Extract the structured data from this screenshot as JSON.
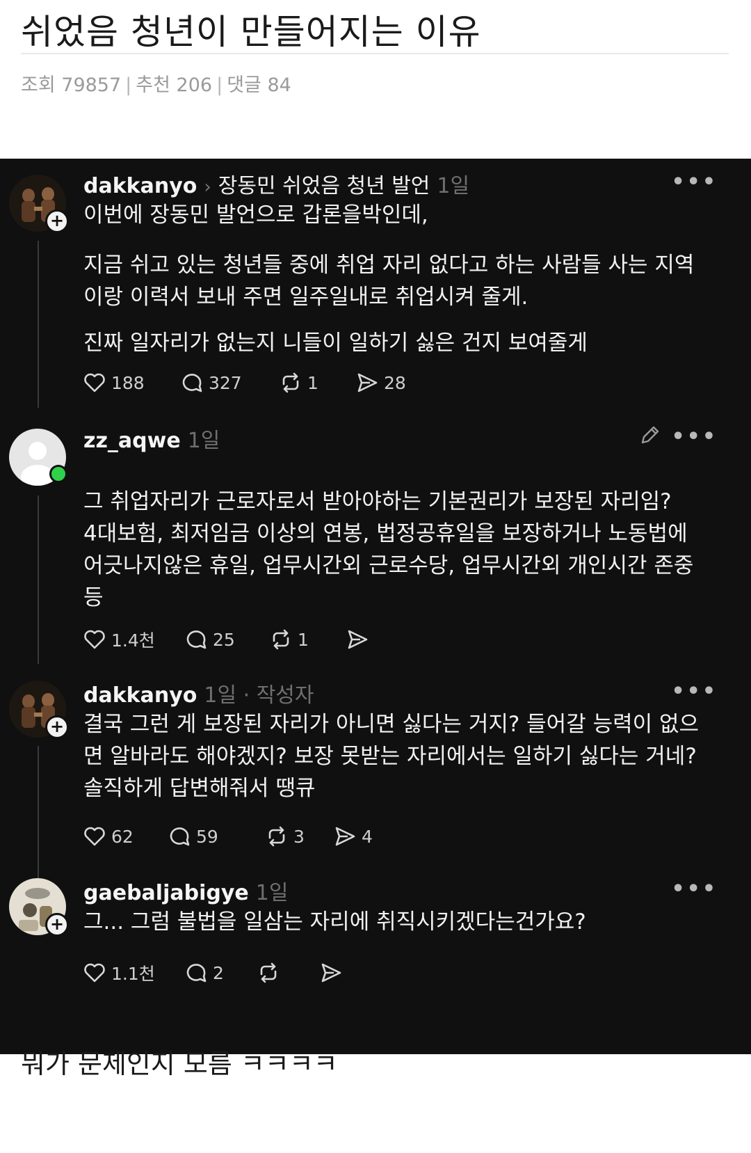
{
  "post": {
    "title": "쉬었음 청년이 만들어지는 이유",
    "views_label": "조회 79857",
    "recommend_label": "추천 206",
    "comments_label": "댓글 84",
    "footer": "뭐가 문제인지 모름 ㅋㅋㅋㅋ"
  },
  "threads": [
    {
      "username": "dakkanyo",
      "reply_target": "장동민 쉬었음 청년 발언",
      "time": "1일",
      "author_tag": "",
      "paragraphs": [
        "이번에 장동민 발언으로 갑론을박인데,",
        "지금 쉬고 있는 청년들 중에 취업 자리 없다고 하는 사람들 사는 지역이랑 이력서 보내 주면 일주일내로 취업시켜 줄게.",
        "진짜 일자리가 없는지 니들이 일하기 싫은 건지 보여줄게"
      ],
      "likes": "188",
      "replies": "327",
      "reposts": "1",
      "shares": "28"
    },
    {
      "username": "zz_aqwe",
      "reply_target": "",
      "time": "1일",
      "author_tag": "",
      "paragraphs": [
        "그 취업자리가 근로자로서 받아야하는 기본권리가 보장된 자리임?\n4대보험, 최저임금 이상의 연봉, 법정공휴일을 보장하거나 노동법에 어긋나지않은 휴일, 업무시간외 근로수당, 업무시간외 개인시간 존중 등"
      ],
      "likes": "1.4천",
      "replies": "25",
      "reposts": "1",
      "shares": ""
    },
    {
      "username": "dakkanyo",
      "reply_target": "",
      "time": "1일",
      "author_tag": "· 작성자",
      "paragraphs": [
        "결국 그런 게 보장된 자리가 아니면 싫다는 거지? 들어갈 능력이 없으면 알바라도 해야겠지? 보장 못받는 자리에서는 일하기 싫다는 거네? 솔직하게 답변해줘서 땡큐"
      ],
      "likes": "62",
      "replies": "59",
      "reposts": "3",
      "shares": "4"
    },
    {
      "username": "gaebaljabigye",
      "reply_target": "",
      "time": "1일",
      "author_tag": "",
      "paragraphs": [
        "그... 그럼 불법을 일삼는 자리에 취직시키겠다는건가요?"
      ],
      "likes": "1.1천",
      "replies": "2",
      "reposts": "",
      "shares": ""
    }
  ],
  "icons": {
    "like": "heart-icon",
    "reply": "comment-bubble-icon",
    "repost": "repost-icon",
    "share": "send-icon",
    "more": "more-horizontal-icon",
    "edit": "pencil-icon"
  },
  "colors": {
    "screenshot_bg": "#101010",
    "online": "#2fd04a",
    "muted": "#6f6f6f"
  }
}
